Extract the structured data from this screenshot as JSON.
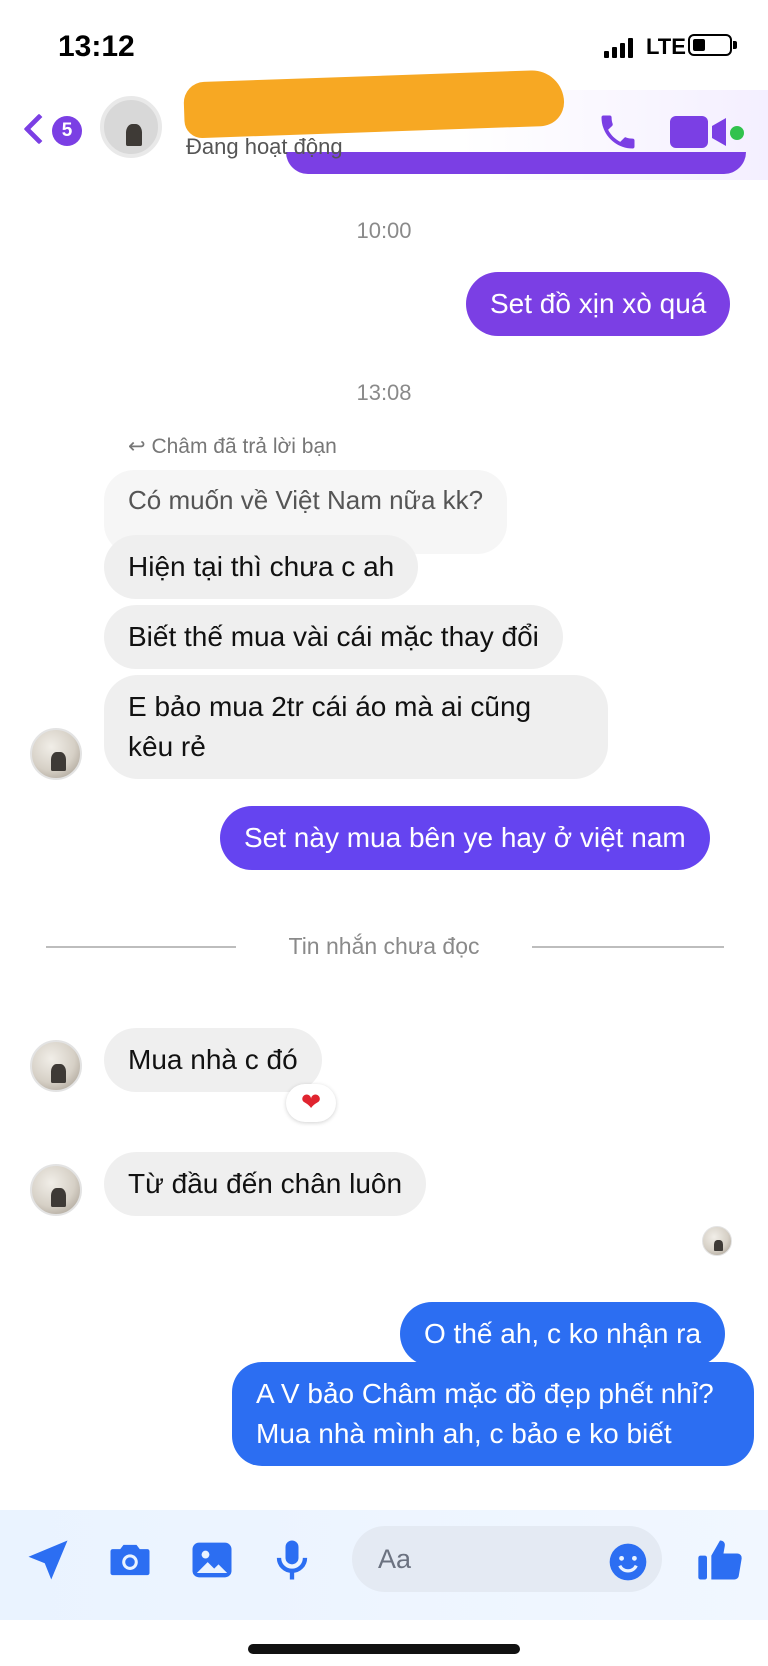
{
  "status_bar": {
    "time": "13:12",
    "network": "LTE"
  },
  "header": {
    "unread_count": "5",
    "contact_status": "Đang hoạt động",
    "accent_color": "#7b3fe4"
  },
  "messages": {
    "ts1": "10:00",
    "m1": "Set đồ xịn xò quá",
    "ts2": "13:08",
    "reply_hint": "Châm đã trả lời bạn",
    "quoted": "Có muốn về Việt Nam nữa kk?",
    "m2": "Hiện tại thì chưa c ah",
    "m3": "Biết thế mua vài cái mặc thay đổi",
    "m4": "E bảo mua 2tr cái áo mà ai cũng kêu rẻ",
    "m5": "Set này mua bên ye hay ở việt nam",
    "divider": "Tin nhắn chưa đọc",
    "m6": "Mua nhà c đó",
    "m6_reaction": "heart-reaction",
    "m7": "Từ đầu đến chân luôn",
    "m8": "O thế ah, c ko nhận ra",
    "m9": "A V bảo Châm mặc đồ đẹp phết nhỉ? Mua nhà mình ah, c bảo e ko biết"
  },
  "composer": {
    "placeholder": "Aa",
    "icons": [
      "send-location-icon",
      "camera-icon",
      "gallery-icon",
      "microphone-icon",
      "emoji-icon",
      "thumbs-up-icon"
    ],
    "accent_color": "#2c6ef2"
  }
}
